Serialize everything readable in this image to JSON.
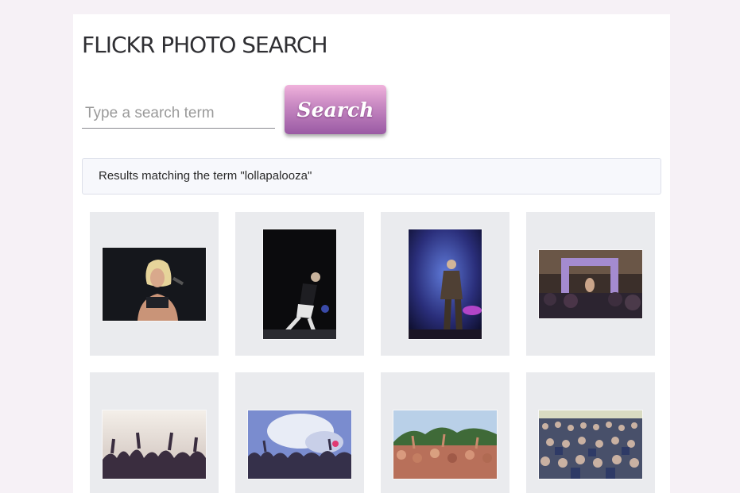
{
  "header": {
    "title": "FLICKR PHOTO SEARCH"
  },
  "search": {
    "placeholder": "Type a search term",
    "value": "",
    "button_label": "Search"
  },
  "results": {
    "message": "Results matching the term \"lollapalooza\""
  },
  "photos": [
    {
      "subject": "singer-blonde-microphone"
    },
    {
      "subject": "performer-on-dark-stage"
    },
    {
      "subject": "singer-purple-stage-lights"
    },
    {
      "subject": "crowd-ornate-frame"
    },
    {
      "subject": "crowd-hands-raised-white-sky"
    },
    {
      "subject": "crowd-smoke-blue-sky"
    },
    {
      "subject": "crowd-cheering-trees"
    },
    {
      "subject": "large-festival-crowd"
    }
  ],
  "colors": {
    "page_background": "#f6f1f6",
    "button_gradient_top": "#f0b2dc",
    "button_gradient_bottom": "#9a5aa4",
    "tile_background": "#eaebee"
  }
}
